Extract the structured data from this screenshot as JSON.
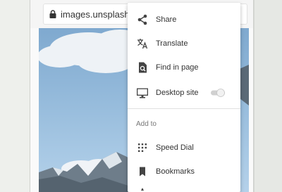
{
  "browser": {
    "url": "images.unsplash.com"
  },
  "menu": {
    "items": [
      {
        "label": "Share",
        "icon": "share-icon"
      },
      {
        "label": "Translate",
        "icon": "translate-icon"
      },
      {
        "label": "Find in page",
        "icon": "find-in-page-icon"
      },
      {
        "label": "Desktop site",
        "icon": "desktop-icon"
      }
    ],
    "desktop_site_enabled": false,
    "section_label": "Add to",
    "add_to_items": [
      {
        "label": "Speed Dial",
        "icon": "speed-dial-icon"
      },
      {
        "label": "Bookmarks",
        "icon": "bookmark-icon"
      }
    ]
  },
  "colors": {
    "icon": "#444444",
    "sky": "#8fb5d8"
  }
}
